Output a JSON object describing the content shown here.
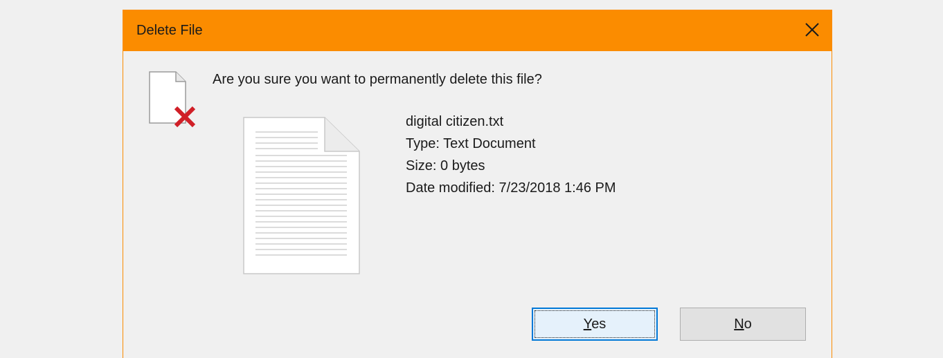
{
  "dialog": {
    "title": "Delete File",
    "close_icon": "close-icon",
    "warning_icon": "file-delete-icon",
    "question": "Are you sure you want to permanently delete this file?",
    "file": {
      "name": "digital citizen.txt",
      "type": "Type: Text Document",
      "size": "Size: 0 bytes",
      "date_modified": "Date modified: 7/23/2018 1:46 PM",
      "icon": "text-document-icon"
    },
    "buttons": {
      "yes": {
        "mnemonic": "Y",
        "rest": "es"
      },
      "no": {
        "mnemonic": "N",
        "rest": "o"
      }
    },
    "colors": {
      "titlebar": "#fb8c00",
      "background": "#f0f0f0",
      "focus_border": "#0078d7"
    }
  }
}
